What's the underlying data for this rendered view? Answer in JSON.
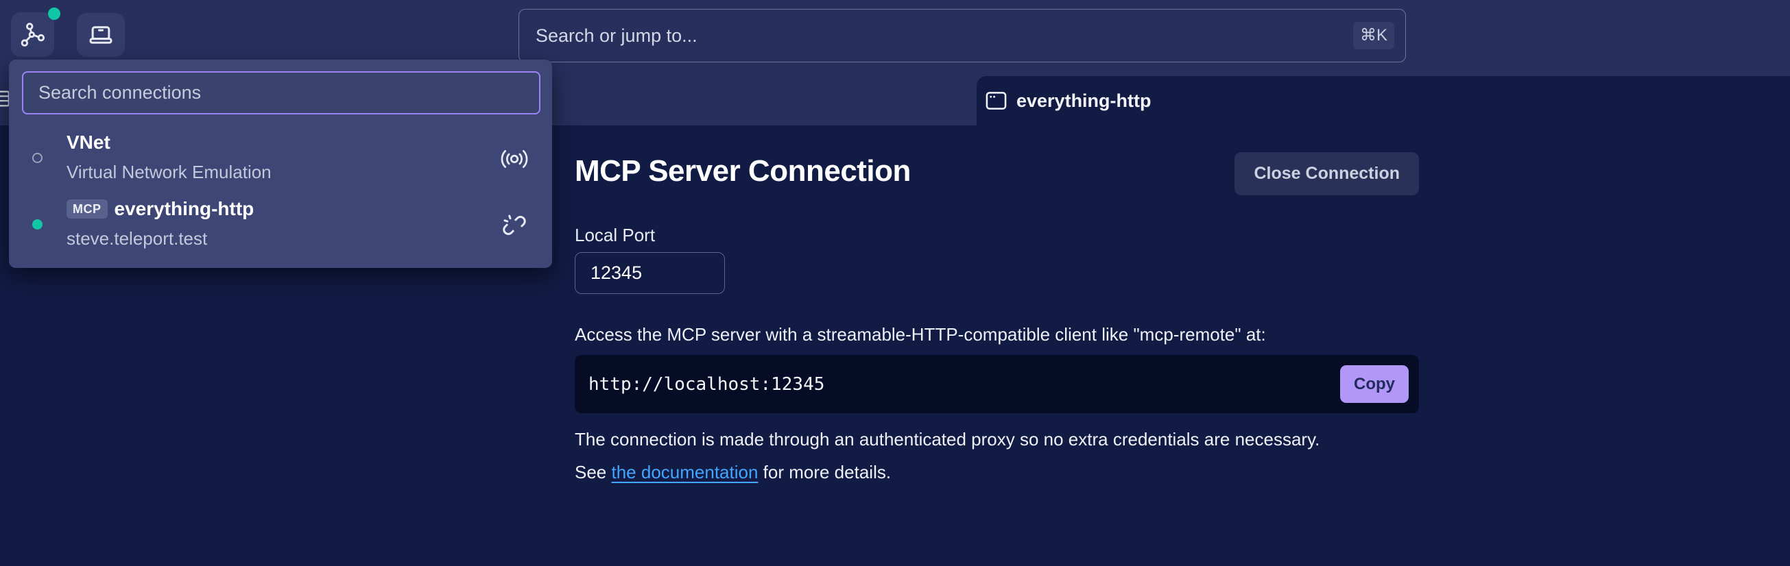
{
  "topbar": {
    "search_placeholder": "Search or jump to...",
    "shortcut_badge": "⌘K"
  },
  "panel": {
    "search_placeholder": "Search connections",
    "items": [
      {
        "title": "VNet",
        "subtitle": "Virtual Network Emulation",
        "status": "offline",
        "trailing_icon": "broadcast-icon"
      },
      {
        "badge": "MCP",
        "title": "everything-http",
        "subtitle": "steve.teleport.test",
        "status": "online",
        "trailing_icon": "disconnect-icon"
      }
    ]
  },
  "tab": {
    "label": "everything-http"
  },
  "main": {
    "title": "MCP Server Connection",
    "close_button": "Close Connection",
    "local_port_label": "Local Port",
    "local_port_value": "12345",
    "access_text": "Access the MCP server with a streamable-HTTP-compatible client like \"mcp-remote\" at:",
    "server_url": "http://localhost:12345",
    "copy_button": "Copy",
    "note_line1": "The connection is made through an authenticated proxy so no extra credentials are necessary.",
    "note_see": "See ",
    "note_link": "the documentation",
    "note_rest": " for more details."
  },
  "colors": {
    "chrome": "#272f5d",
    "panel": "#3e4675",
    "main_bg": "#121b44",
    "code_bg": "#060c26",
    "accent_purple": "#b197f7",
    "purple_border": "#9b84f5",
    "teal": "#10c7a5",
    "link_blue": "#42a5ff"
  }
}
